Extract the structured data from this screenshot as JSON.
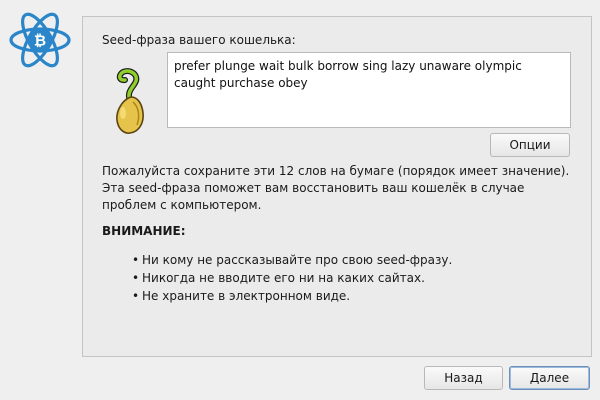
{
  "seed": {
    "heading": "Seed-фраза вашего кошелька:",
    "phrase": "prefer plunge wait bulk borrow sing lazy unaware olympic caught purchase obey",
    "options_label": "Опции"
  },
  "info": {
    "paragraph": "Пожалуйста сохраните эти 12 слов на бумаге (порядок имеет значение). Эта seed-фраза поможет вам восстановить ваш кошелёк в случае проблем с компьютером.",
    "warning_title": "ВНИМАНИЕ:",
    "bullets": [
      "Ни кому не рассказывайте про свою seed-фразу.",
      "Никогда не вводите его ни на каких сайтах.",
      "Не храните в электронном виде."
    ]
  },
  "nav": {
    "back_label": "Назад",
    "next_label": "Далее"
  },
  "icons": {
    "app_logo": "electrum-bitcoin-atom-icon",
    "seed": "sprouting-seed-icon"
  },
  "colors": {
    "logo_blue": "#2a86c9",
    "default_button_border": "#6d8fb8"
  }
}
